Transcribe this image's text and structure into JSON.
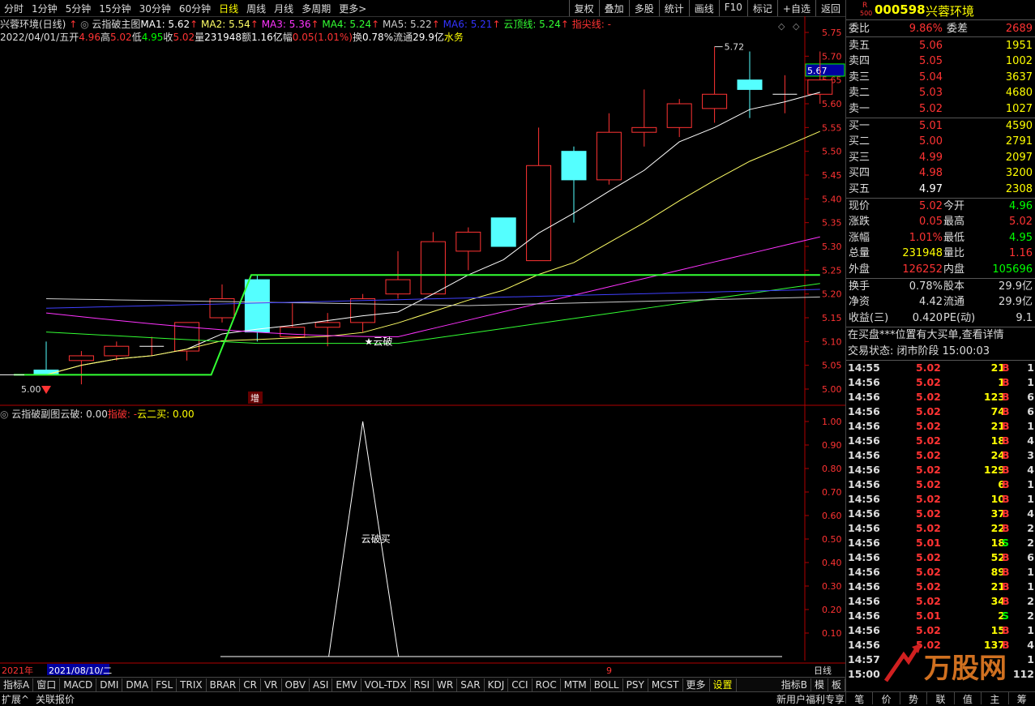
{
  "toolbar": {
    "periods": [
      "分时",
      "1分钟",
      "5分钟",
      "15分钟",
      "30分钟",
      "60分钟",
      "日线",
      "周线",
      "月线",
      "多周期",
      "更多>"
    ],
    "active_period": "日线",
    "tools": [
      "复权",
      "叠加",
      "多股",
      "统计",
      "画线",
      "F10",
      "标记",
      "+自选",
      "返回"
    ]
  },
  "main_chart": {
    "title": "兴蓉环境(日线)",
    "indicator": "云指破主图",
    "ma": [
      {
        "label": "MA1: 5.62",
        "color": "#ffffff"
      },
      {
        "label": "MA2: 5.54",
        "color": "#ffff66"
      },
      {
        "label": "MA3: 5.36",
        "color": "#ff33ff"
      },
      {
        "label": "MA4: 5.24",
        "color": "#33ff33"
      },
      {
        "label": "MA5: 5.22",
        "color": "#cccccc"
      },
      {
        "label": "MA6: 5.21",
        "color": "#3333ff"
      }
    ],
    "cloud_top": "云顶线: 5.24",
    "tip_line": "指尖线: -",
    "info_date": "2022/04/01/五",
    "info": [
      {
        "label": "开",
        "value": "4.96",
        "color": "#ff3333"
      },
      {
        "label": "高",
        "value": "5.02",
        "color": "#ff3333"
      },
      {
        "label": "低",
        "value": "4.95",
        "color": "#00ff00"
      },
      {
        "label": "收",
        "value": "5.02",
        "color": "#ff3333"
      },
      {
        "label": "量",
        "value": "231948",
        "color": "#ffffff"
      },
      {
        "label": "额",
        "value": "1.16亿",
        "color": "#ffffff"
      },
      {
        "label": "幅",
        "value": "0.05(1.01%)",
        "color": "#ff3333"
      },
      {
        "label": "换",
        "value": "0.78%",
        "color": "#ffffff"
      },
      {
        "label": "流通",
        "value": "29.9亿",
        "color": "#ffffff"
      },
      {
        "label": "",
        "value": "水务",
        "color": "#ffff00"
      }
    ],
    "y_ticks": [
      "5.75",
      "5.70",
      "5.65",
      "5.60",
      "5.55",
      "5.50",
      "5.45",
      "5.40",
      "5.35",
      "5.30",
      "5.25",
      "5.20",
      "5.15",
      "5.10",
      "5.05",
      "5.00"
    ],
    "current_price_tag": "5.67",
    "high_label": "5.72",
    "low_label": "5.00",
    "signal_label": "★云破",
    "zeng_label": "增",
    "candles": [
      {
        "o": 5.04,
        "h": 5.1,
        "l": 5.03,
        "c": 5.03
      },
      {
        "o": 5.06,
        "h": 5.08,
        "l": 5.01,
        "c": 5.07
      },
      {
        "o": 5.07,
        "h": 5.1,
        "l": 5.06,
        "c": 5.09
      },
      {
        "o": 5.09,
        "h": 5.11,
        "l": 5.07,
        "c": 5.09
      },
      {
        "o": 5.08,
        "h": 5.14,
        "l": 5.06,
        "c": 5.14
      },
      {
        "o": 5.15,
        "h": 5.22,
        "l": 5.14,
        "c": 5.19
      },
      {
        "o": 5.23,
        "h": 5.24,
        "l": 5.1,
        "c": 5.12
      },
      {
        "o": 5.11,
        "h": 5.18,
        "l": 5.11,
        "c": 5.13
      },
      {
        "o": 5.13,
        "h": 5.16,
        "l": 5.09,
        "c": 5.14
      },
      {
        "o": 5.14,
        "h": 5.2,
        "l": 5.12,
        "c": 5.19
      },
      {
        "o": 5.2,
        "h": 5.29,
        "l": 5.19,
        "c": 5.23
      },
      {
        "o": 5.2,
        "h": 5.33,
        "l": 5.2,
        "c": 5.31
      },
      {
        "o": 5.29,
        "h": 5.34,
        "l": 5.25,
        "c": 5.33
      },
      {
        "o": 5.36,
        "h": 5.36,
        "l": 5.3,
        "c": 5.3
      },
      {
        "o": 5.27,
        "h": 5.55,
        "l": 5.27,
        "c": 5.47
      },
      {
        "o": 5.5,
        "h": 5.51,
        "l": 5.35,
        "c": 5.44
      },
      {
        "o": 5.44,
        "h": 5.58,
        "l": 5.43,
        "c": 5.54
      },
      {
        "o": 5.54,
        "h": 5.63,
        "l": 5.51,
        "c": 5.55
      },
      {
        "o": 5.55,
        "h": 5.61,
        "l": 5.53,
        "c": 5.6
      },
      {
        "o": 5.59,
        "h": 5.72,
        "l": 5.56,
        "c": 5.62
      },
      {
        "o": 5.65,
        "h": 5.71,
        "l": 5.57,
        "c": 5.63
      },
      {
        "o": 5.62,
        "h": 5.66,
        "l": 5.58,
        "c": 5.62
      },
      {
        "o": 5.62,
        "h": 5.71,
        "l": 5.6,
        "c": 5.65
      }
    ]
  },
  "sub_chart": {
    "title": "云指破副图",
    "yunpo": "云破: 0.00",
    "zhipo": "指破: -",
    "yun2": "云二买: 0.00",
    "y_ticks": [
      "1.00",
      "0.90",
      "0.80",
      "0.70",
      "0.60",
      "0.50",
      "0.40",
      "0.30",
      "0.20",
      "0.10"
    ],
    "peak_label": "云破买"
  },
  "time_axis": {
    "year": "2021年",
    "date": "2021/08/10/二",
    "mid": "9",
    "period": "日线"
  },
  "bottom_tabs": [
    "指标A",
    "窗口",
    "MACD",
    "DMI",
    "DMA",
    "FSL",
    "TRIX",
    "BRAR",
    "CR",
    "VR",
    "OBV",
    "ASI",
    "EMV",
    "VOL-TDX",
    "RSI",
    "WR",
    "SAR",
    "KDJ",
    "CCI",
    "ROC",
    "MTM",
    "BOLL",
    "PSY",
    "MCST",
    "更多",
    "设置"
  ],
  "bottom_right": [
    "指标B",
    "模",
    "板"
  ],
  "status": {
    "left": [
      "扩展^",
      "关联报价"
    ],
    "right": "新用户福利专享"
  },
  "quote": {
    "code": "000598",
    "name": "兴蓉环境",
    "r_badge": "R",
    "idx_badge": "500",
    "weibi_label": "委比",
    "weibi": "9.86%",
    "weicha_label": "委差",
    "weicha": "2689",
    "asks": [
      {
        "label": "卖五",
        "price": "5.06",
        "vol": "1951"
      },
      {
        "label": "卖四",
        "price": "5.05",
        "vol": "1002"
      },
      {
        "label": "卖三",
        "price": "5.04",
        "vol": "3637"
      },
      {
        "label": "卖二",
        "price": "5.03",
        "vol": "4680"
      },
      {
        "label": "卖一",
        "price": "5.02",
        "vol": "1027"
      }
    ],
    "bids": [
      {
        "label": "买一",
        "price": "5.01",
        "vol": "4590"
      },
      {
        "label": "买二",
        "price": "5.00",
        "vol": "2791"
      },
      {
        "label": "买三",
        "price": "4.99",
        "vol": "2097"
      },
      {
        "label": "买四",
        "price": "4.98",
        "vol": "3200"
      },
      {
        "label": "买五",
        "price": "4.97",
        "vol": "2308"
      }
    ],
    "stats": [
      {
        "l1": "现价",
        "v1": "5.02",
        "c1": "#ff3333",
        "l2": "今开",
        "v2": "4.96",
        "c2": "#00ff00"
      },
      {
        "l1": "涨跌",
        "v1": "0.05",
        "c1": "#ff3333",
        "l2": "最高",
        "v2": "5.02",
        "c2": "#ff3333"
      },
      {
        "l1": "涨幅",
        "v1": "1.01%",
        "c1": "#ff3333",
        "l2": "最低",
        "v2": "4.95",
        "c2": "#00ff00"
      },
      {
        "l1": "总量",
        "v1": "231948",
        "c1": "#ffff00",
        "l2": "量比",
        "v2": "1.16",
        "c2": "#ff3333"
      },
      {
        "l1": "外盘",
        "v1": "126252",
        "c1": "#ff3333",
        "l2": "内盘",
        "v2": "105696",
        "c2": "#00ff00"
      }
    ],
    "stats2": [
      {
        "l1": "换手",
        "v1": "0.78%",
        "l2": "股本",
        "v2": "29.9亿"
      },
      {
        "l1": "净资",
        "v1": "4.42",
        "l2": "流通",
        "v2": "29.9亿"
      },
      {
        "l1": "收益(三)",
        "v1": "0.420",
        "l2": "PE(动)",
        "v2": "9.1"
      }
    ],
    "notice": "在买盘***位置有大买单,查看详情",
    "trade_state": "交易状态: 闭市阶段 15:00:03",
    "ticks": [
      {
        "t": "14:55",
        "p": "5.02",
        "v": "21",
        "s": "B",
        "n": "1"
      },
      {
        "t": "14:56",
        "p": "5.02",
        "v": "1",
        "s": "B",
        "n": "1"
      },
      {
        "t": "14:56",
        "p": "5.02",
        "v": "123",
        "s": "B",
        "n": "6"
      },
      {
        "t": "14:56",
        "p": "5.02",
        "v": "74",
        "s": "B",
        "n": "6"
      },
      {
        "t": "14:56",
        "p": "5.02",
        "v": "21",
        "s": "B",
        "n": "1"
      },
      {
        "t": "14:56",
        "p": "5.02",
        "v": "18",
        "s": "B",
        "n": "4"
      },
      {
        "t": "14:56",
        "p": "5.02",
        "v": "24",
        "s": "B",
        "n": "3"
      },
      {
        "t": "14:56",
        "p": "5.02",
        "v": "129",
        "s": "B",
        "n": "4"
      },
      {
        "t": "14:56",
        "p": "5.02",
        "v": "6",
        "s": "B",
        "n": "1"
      },
      {
        "t": "14:56",
        "p": "5.02",
        "v": "10",
        "s": "B",
        "n": "1"
      },
      {
        "t": "14:56",
        "p": "5.02",
        "v": "37",
        "s": "B",
        "n": "4"
      },
      {
        "t": "14:56",
        "p": "5.02",
        "v": "22",
        "s": "B",
        "n": "2"
      },
      {
        "t": "14:56",
        "p": "5.01",
        "v": "18",
        "s": "S",
        "n": "2"
      },
      {
        "t": "14:56",
        "p": "5.02",
        "v": "52",
        "s": "B",
        "n": "6"
      },
      {
        "t": "14:56",
        "p": "5.02",
        "v": "89",
        "s": "B",
        "n": "1"
      },
      {
        "t": "14:56",
        "p": "5.02",
        "v": "21",
        "s": "B",
        "n": "1"
      },
      {
        "t": "14:56",
        "p": "5.02",
        "v": "34",
        "s": "B",
        "n": "2"
      },
      {
        "t": "14:56",
        "p": "5.01",
        "v": "2",
        "s": "S",
        "n": "2"
      },
      {
        "t": "14:56",
        "p": "5.02",
        "v": "15",
        "s": "B",
        "n": "1"
      },
      {
        "t": "14:56",
        "p": "5.02",
        "v": "137",
        "s": "B",
        "n": "4"
      },
      {
        "t": "14:57",
        "p": "",
        "v": "",
        "s": "",
        "n": "1"
      },
      {
        "t": "15:00",
        "p": "",
        "v": "",
        "s": "",
        "n": "112"
      }
    ],
    "bottom_tabs": [
      "笔",
      "价",
      "势",
      "联",
      "值",
      "主",
      "筹"
    ]
  },
  "watermark": "万股网"
}
